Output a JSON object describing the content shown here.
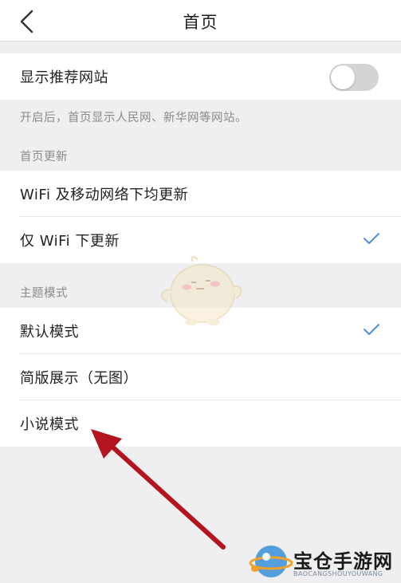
{
  "header": {
    "title": "首页",
    "back_icon": "chevron-left-icon"
  },
  "recommend": {
    "label": "显示推荐网站",
    "enabled": false,
    "note": "开启后，首页显示人民网、新华网等网站。"
  },
  "update_section": {
    "heading": "首页更新",
    "options": [
      {
        "label": "WiFi 及移动网络下均更新",
        "selected": false
      },
      {
        "label": "仅 WiFi 下更新",
        "selected": true
      }
    ]
  },
  "theme_section": {
    "heading": "主题模式",
    "options": [
      {
        "label": "默认模式",
        "selected": true
      },
      {
        "label": "简版展示（无图）",
        "selected": false
      },
      {
        "label": "小说模式",
        "selected": false
      }
    ]
  },
  "watermark": {
    "brand": "宝仓手游网",
    "sub": "BAOCANGSHOUYOUWANG"
  },
  "colors": {
    "accent_check": "#4a90e2",
    "annotation_arrow": "#b3141e",
    "toggle_off": "#d4d4d6",
    "page_bg": "#efeff1"
  }
}
